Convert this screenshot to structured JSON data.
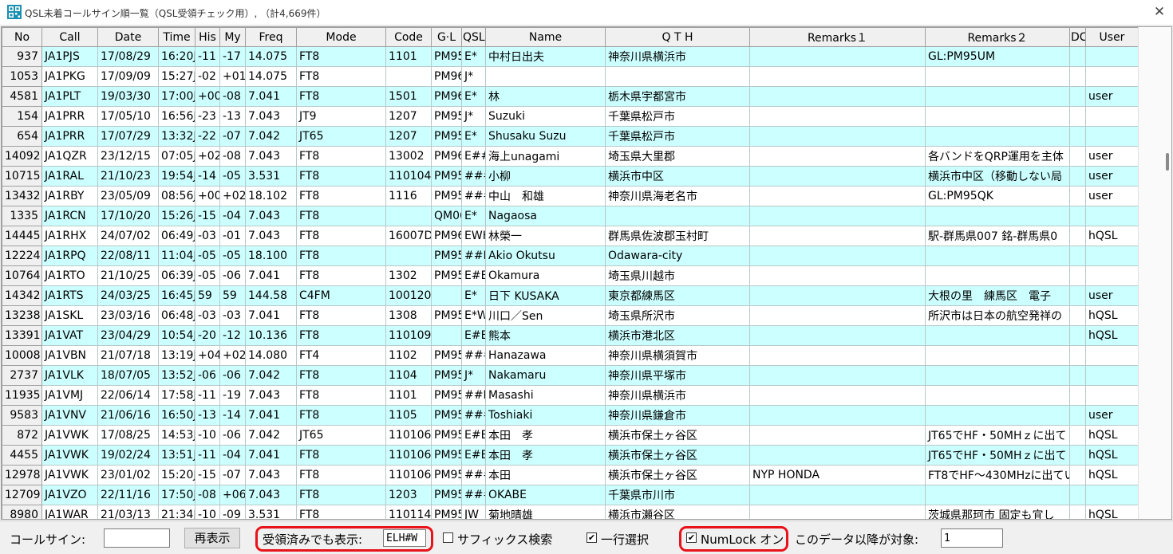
{
  "window": {
    "title": "QSL未着コールサイン順一覧（QSL受領チェック用）, （計4,669件）",
    "close_glyph": "✕"
  },
  "columns": [
    "No",
    "Call",
    "Date",
    "Time",
    "His",
    "My",
    "Freq",
    "Mode",
    "Code",
    "G·L",
    "QSL",
    "Name",
    "Q T H",
    "Remarks１",
    "Remarks２",
    "DC",
    "User"
  ],
  "rows": [
    [
      "937",
      "JA1PJS",
      "17/08/29",
      "16:20J",
      "-11",
      "-17",
      "14.075",
      "FT8",
      "1101",
      "PM95",
      "E*",
      "中村日出夫",
      "神奈川県横浜市",
      "",
      "GL:PM95UM",
      "",
      ""
    ],
    [
      "1053",
      "JA1PKG",
      "17/09/09",
      "15:27J",
      "-02",
      "+01",
      "14.075",
      "FT8",
      "",
      "PM96",
      "J*",
      "",
      "",
      "",
      "",
      "",
      ""
    ],
    [
      "4581",
      "JA1PLT",
      "19/03/30",
      "17:00J",
      "+00",
      "-08",
      "7.041",
      "FT8",
      "1501",
      "PM96",
      "E*",
      "林",
      "栃木県宇都宮市",
      "",
      "",
      "",
      "user"
    ],
    [
      "154",
      "JA1PRR",
      "17/05/10",
      "16:56J",
      "-23",
      "-13",
      "7.043",
      "JT9",
      "1207",
      "PM95",
      "J*",
      "Suzuki",
      "千葉県松戸市",
      "",
      "",
      "",
      ""
    ],
    [
      "654",
      "JA1PRR",
      "17/07/29",
      "13:32J",
      "-22",
      "-07",
      "7.042",
      "JT65",
      "1207",
      "PM95",
      "E*",
      "Shusaku Suzu",
      "千葉県松戸市",
      "",
      "",
      "",
      ""
    ],
    [
      "14092",
      "JA1QZR",
      "23/12/15",
      "07:05J",
      "+02",
      "-08",
      "7.043",
      "FT8",
      "13002",
      "PM96",
      "E##",
      "海上unagami",
      "埼玉県大里郡",
      "",
      "各バンドをQRP運用を主体",
      "",
      "user"
    ],
    [
      "10715",
      "JA1RAL",
      "21/10/23",
      "19:54J",
      "-14",
      "-05",
      "3.531",
      "FT8",
      "110104",
      "PM95",
      "###",
      "小柳",
      "横浜市中区",
      "",
      "横浜市中区（移動しない局",
      "",
      "user"
    ],
    [
      "13432",
      "JA1RBY",
      "23/05/09",
      "08:56J",
      "+00",
      "+02",
      "18.102",
      "FT8",
      "1116",
      "PM95",
      "###",
      "中山　和雄",
      "神奈川県海老名市",
      "",
      "GL:PM95QK",
      "",
      "user"
    ],
    [
      "1335",
      "JA1RCN",
      "17/10/20",
      "15:26J",
      "-15",
      "-04",
      "7.043",
      "FT8",
      "",
      "QM06",
      "E*",
      "Nagaosa",
      "",
      "",
      "",
      "",
      ""
    ],
    [
      "14445",
      "JA1RHX",
      "24/07/02",
      "06:49J",
      "-03",
      "-01",
      "7.043",
      "FT8",
      "16007D",
      "PM96",
      "EWH",
      "林榮一",
      "群馬県佐波郡玉村町",
      "",
      "駅-群馬県007 銘-群馬県0",
      "",
      "hQSL"
    ],
    [
      "12224",
      "JA1RPQ",
      "22/08/11",
      "11:04J",
      "-05",
      "-05",
      "18.100",
      "FT8",
      "",
      "PM95",
      "##E",
      "Akio Okutsu",
      "Odawara-city",
      "",
      "",
      "",
      ""
    ],
    [
      "10764",
      "JA1RTO",
      "21/10/25",
      "06:39J",
      "-05",
      "-06",
      "7.041",
      "FT8",
      "1302",
      "PM95",
      "E#E",
      "Okamura",
      "埼玉県川越市",
      "",
      "",
      "",
      ""
    ],
    [
      "14342",
      "JA1RTS",
      "24/03/25",
      "16:45J",
      "59",
      "59",
      "144.58",
      "C4FM",
      "100120",
      "",
      "E*",
      "日下 KUSAKA",
      "東京都練馬区",
      "",
      "大根の里　練馬区　電子",
      "",
      "user"
    ],
    [
      "13238",
      "JA1SKL",
      "23/03/16",
      "06:48J",
      "-03",
      "-03",
      "7.041",
      "FT8",
      "1308",
      "PM95",
      "E*W",
      "川口／Sen",
      "埼玉県所沢市",
      "",
      "所沢市は日本の航空発祥の",
      "",
      "hQSL"
    ],
    [
      "13391",
      "JA1VAT",
      "23/04/29",
      "10:54J",
      "-20",
      "-12",
      "10.136",
      "FT8",
      "110109",
      "",
      "E#E",
      "熊本",
      "横浜市港北区",
      "",
      "",
      "",
      "hQSL"
    ],
    [
      "10008",
      "JA1VBN",
      "21/07/18",
      "13:19J",
      "+04",
      "+02",
      "14.080",
      "FT4",
      "1102",
      "PM95",
      "###",
      "Hanazawa",
      "神奈川県横須賀市",
      "",
      "",
      "",
      ""
    ],
    [
      "2737",
      "JA1VLK",
      "18/07/05",
      "13:52J",
      "-06",
      "-06",
      "7.042",
      "FT8",
      "1104",
      "PM95",
      "J*",
      "Nakamaru",
      "神奈川県平塚市",
      "",
      "",
      "",
      ""
    ],
    [
      "11935",
      "JA1VMJ",
      "22/06/14",
      "17:58J",
      "-11",
      "-19",
      "7.043",
      "FT8",
      "1101",
      "PM95",
      "##E",
      "Masashi",
      "神奈川県横浜市",
      "",
      "",
      "",
      ""
    ],
    [
      "9583",
      "JA1VNV",
      "21/06/16",
      "16:50J",
      "-13",
      "-14",
      "7.041",
      "FT8",
      "1105",
      "PM95",
      "###",
      "Toshiaki",
      "神奈川県鎌倉市",
      "",
      "",
      "",
      "user"
    ],
    [
      "872",
      "JA1VWK",
      "17/08/25",
      "14:53J",
      "-10",
      "-06",
      "7.042",
      "JT65",
      "110106",
      "PM95",
      "E#E",
      "本田　孝",
      "横浜市保土ヶ谷区",
      "",
      "JT65でHF・50MHｚに出て",
      "",
      "hQSL"
    ],
    [
      "4455",
      "JA1VWK",
      "19/02/24",
      "13:51J",
      "-11",
      "-04",
      "7.041",
      "FT8",
      "110106",
      "PM95",
      "E#E",
      "本田　孝",
      "横浜市保土ヶ谷区",
      "",
      "JT65でHF・50MHｚに出て",
      "",
      "hQSL"
    ],
    [
      "12978",
      "JA1VWK",
      "23/01/02",
      "15:20J",
      "-15",
      "-07",
      "7.043",
      "FT8",
      "110106",
      "PM95",
      "###",
      "本田",
      "横浜市保土ヶ谷区",
      "NYP HONDA",
      "FT8でHF～430MHzに出てい",
      "",
      "hQSL"
    ],
    [
      "12709",
      "JA1VZO",
      "22/11/16",
      "17:50J",
      "-08",
      "+06",
      "7.043",
      "FT8",
      "1203",
      "PM95",
      "###",
      "OKABE",
      "千葉県市川市",
      "",
      "",
      "",
      ""
    ],
    [
      "8980",
      "JA1WAR",
      "21/03/13",
      "21:34J",
      "-10",
      "-09",
      "3.531",
      "FT8",
      "110114",
      "PM95",
      "JW",
      "菊地晴雄",
      "横浜市瀬谷区",
      "",
      "茨城県那珂市 固定も宜し",
      "",
      "hQSL"
    ]
  ],
  "bottom": {
    "callsign_label": "コールサイン:",
    "callsign_value": "",
    "redisplay_button": "再表示",
    "show_received_label": "受領済みでも表示:",
    "show_received_value": "ELH#W",
    "suffix_search_label": "サフィックス検索",
    "suffix_search_checked": false,
    "row_select_label": "一行選択",
    "row_select_checked": true,
    "numlock_label": "NumLock オン",
    "numlock_checked": true,
    "after_data_label": "このデータ以降が対象:",
    "after_data_value": "1"
  },
  "colors": {
    "row_highlight": "#ccffff",
    "row_plain": "#ffffff",
    "annotation_red": "#e8121a"
  }
}
